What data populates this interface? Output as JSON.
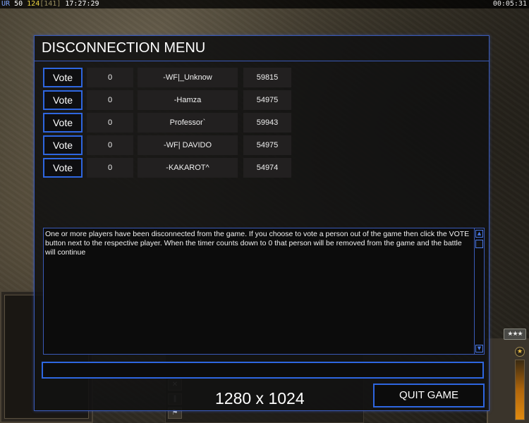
{
  "hud": {
    "left": {
      "mode": "UR",
      "value1": "50",
      "value2": "124",
      "bracket_open": "[",
      "value3": "141",
      "bracket_close": "]",
      "clock": "17:27:29"
    },
    "right_timer": "00:05:31"
  },
  "rank_badge": "★★★",
  "dialog": {
    "title": "DISCONNECTION MENU",
    "vote_label": "Vote",
    "players": [
      {
        "votes": "0",
        "name": "-WF|_Unknow",
        "ping": "59815"
      },
      {
        "votes": "0",
        "name": "-Hamza",
        "ping": "54975"
      },
      {
        "votes": "0",
        "name": "Professor`",
        "ping": "59943"
      },
      {
        "votes": "0",
        "name": "-WF| DAVIDO",
        "ping": "54975"
      },
      {
        "votes": "0",
        "name": "-KAKAROT^",
        "ping": "54974"
      }
    ],
    "message": "One or more players have been disconnected from the game. If you choose to vote a person out of the game then click the VOTE button next to the respective player. When the timer counts down to 0 that person will be removed from the game and the battle will continue",
    "chat_value": "",
    "quit_label": "QUIT GAME",
    "resolution_label": "1280 x 1024"
  },
  "icons": {
    "scroll_up": "▲",
    "scroll_down": "▼",
    "gauge": "★"
  }
}
